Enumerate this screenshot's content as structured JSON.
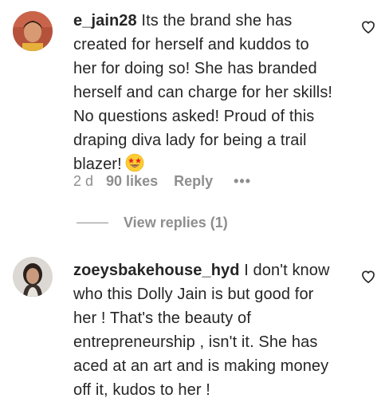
{
  "comments": [
    {
      "username": "e_jain28",
      "text_lines": [
        "Its the brand she has",
        "created for herself and kuddos to",
        "her for doing so! She has branded",
        "herself and can charge for her skills!",
        "No questions asked! Proud of this",
        "draping diva lady for being a trail",
        "blazer!"
      ],
      "emoji": "star-struck-emoji",
      "time": "2 d",
      "likes": "90 likes",
      "reply_label": "Reply",
      "more_label": "•••",
      "view_replies": "View replies (1)"
    },
    {
      "username": "zoeysbakehouse_hyd",
      "text_lines": [
        "I don't know",
        "who this Dolly Jain is but good for",
        "her ! That's the beauty of",
        "entrepreneurship , isn't it. She has",
        "aced at an art and is making money",
        "off it, kudos to her !"
      ]
    }
  ],
  "icons": {
    "like": "heart-outline-icon",
    "emoji": "star-struck-emoji"
  },
  "colors": {
    "text": "#262626",
    "secondary": "#8e8e8e",
    "avatar1_bg": "#a84a3a",
    "avatar2_bg": "#d8d4cf"
  }
}
